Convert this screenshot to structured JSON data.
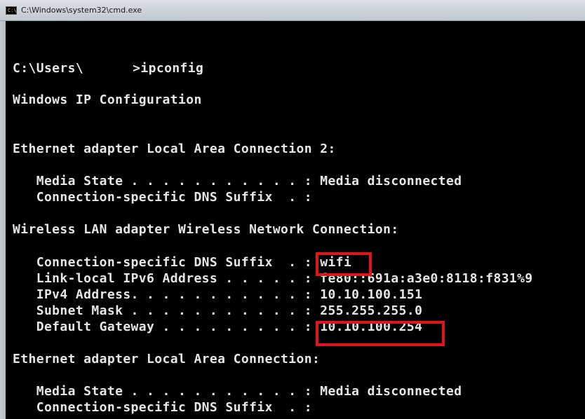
{
  "window": {
    "title": "C:\\Windows\\system32\\cmd.exe",
    "icon": "cmd-console-icon",
    "icon_glyph": "C:\\"
  },
  "console": {
    "prompt_prefix": "C:\\Users\\",
    "prompt_suffix": ">ipconfig",
    "header": "Windows IP Configuration",
    "adapter1_title": "Ethernet adapter Local Area Connection 2:",
    "adapter1_media": "   Media State . . . . . . . . . . . : Media disconnected",
    "adapter1_dns": "   Connection-specific DNS Suffix  . :",
    "adapter2_title": "Wireless LAN adapter Wireless Network Connection:",
    "adapter2_dns_label": "   Connection-specific DNS Suffix  . : ",
    "adapter2_dns_value": "wifi",
    "adapter2_ipv6": "   Link-local IPv6 Address . . . . . : fe80::691a:a3e0:8118:f831%9",
    "adapter2_ipv4": "   IPv4 Address. . . . . . . . . . . : 10.10.100.151",
    "adapter2_subnet": "   Subnet Mask . . . . . . . . . . . : 255.255.255.0",
    "adapter2_gateway_label": "   Default Gateway . . . . . . . . . : ",
    "adapter2_gateway_value": "10.10.100.254",
    "adapter3_title": "Ethernet adapter Local Area Connection:",
    "adapter3_media": "   Media State . . . . . . . . . . . : Media disconnected",
    "adapter3_dns": "   Connection-specific DNS Suffix  . :"
  },
  "colors": {
    "console_background": "#000000",
    "console_text": "#e6e6e6",
    "highlight_border": "#e0141c"
  }
}
